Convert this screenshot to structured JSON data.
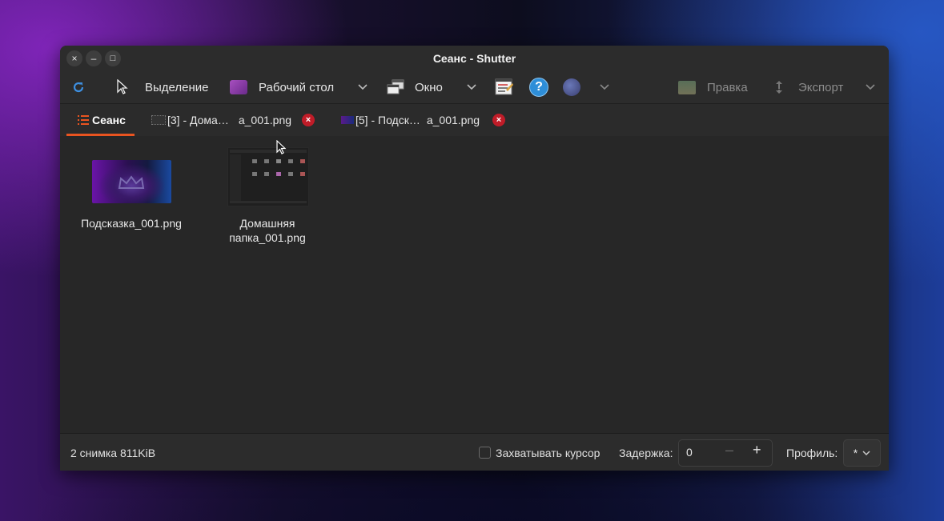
{
  "window": {
    "title": "Сеанс - Shutter",
    "controls": {
      "close": "×",
      "minimize": "–",
      "maximize": "□"
    }
  },
  "toolbar": {
    "selection_label": "Выделение",
    "desktop_label": "Рабочий стол",
    "window_label": "Окно",
    "edit_label": "Правка",
    "export_label": "Экспорт"
  },
  "tabs": [
    {
      "label": "Сеанс",
      "icon": "list-icon"
    },
    {
      "label_start": "[3] - Дома…",
      "label_end": "а_001.png",
      "icon": "file-thumbnail-icon"
    },
    {
      "label_start": "[5] - Подск…",
      "label_end": "а_001.png",
      "icon": "file-thumbnail-icon"
    }
  ],
  "files": [
    {
      "name": "Подсказка_001.png"
    },
    {
      "name_line1": "Домашняя",
      "name_line2": "папка_001.png"
    }
  ],
  "status": {
    "summary": "2 снимка  811KiB",
    "capture_cursor_label": "Захватывать курсор",
    "delay_label": "Задержка:",
    "delay_value": "0",
    "profile_label": "Профиль:",
    "profile_value": "*"
  },
  "colors": {
    "accent": "#e95420",
    "close_badge": "#c01c28",
    "help_blue": "#2e8ed8",
    "window_bg": "#272727"
  }
}
